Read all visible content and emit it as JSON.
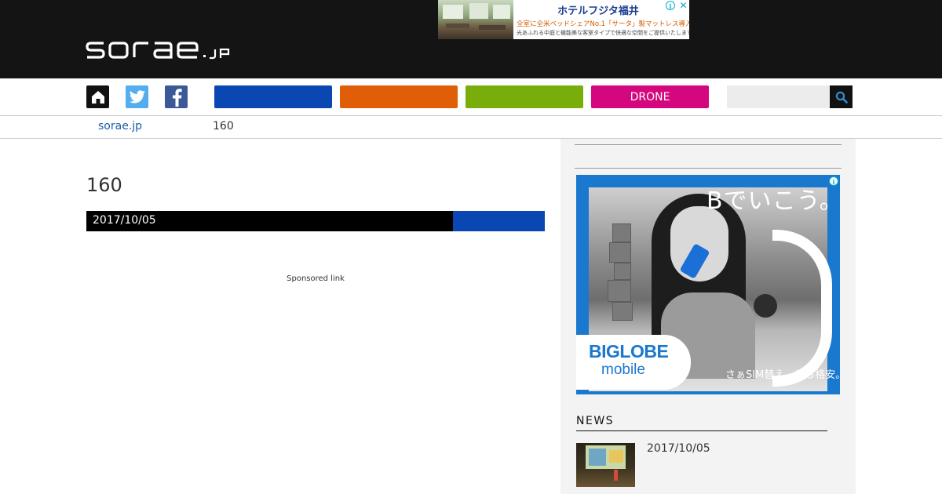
{
  "header": {
    "logo_text": "sorae.jp",
    "top_ad": {
      "title": "ホテルフジタ福井",
      "line1": "全室に全米ベッドシェアNo.1「サータ」製マットレス導入。",
      "line2": "光あふれる中庭と機能美な客室タイプで快適な空間をご提供いたします。",
      "adchoices_icon": "i",
      "close_label": "✕"
    }
  },
  "nav": {
    "home_icon": "home-icon",
    "twitter_icon": "twitter-icon",
    "facebook_icon": "facebook-icon",
    "categories": [
      {
        "label": "",
        "color": "#0b47b3"
      },
      {
        "label": "",
        "color": "#e05e07"
      },
      {
        "label": "",
        "color": "#79ad0c"
      },
      {
        "label": "DRONE",
        "color": "#d4077e"
      }
    ],
    "search": {
      "value": "",
      "placeholder": ""
    },
    "search_icon": "search-icon"
  },
  "breadcrumb": {
    "home": "sorae.jp",
    "current": "160"
  },
  "article": {
    "title": "160",
    "date": "2017/10/05",
    "category_color": "#0b47b3",
    "sponsored_label": "Sponsored link"
  },
  "sidebar": {
    "ad": {
      "headline": "Bでいこう。",
      "brand_top": "BIGLOBE",
      "brand_bottom": "mobile",
      "tagline": "さぁSIM替え、ほら格安。",
      "adchoices_icon": "i"
    },
    "news": {
      "heading": "NEWS",
      "items": [
        {
          "date": "2017/10/05"
        }
      ]
    }
  },
  "colors": {
    "header_bg": "#141414",
    "link": "#1b5ea8",
    "sidebar_bg": "#f2f3f2"
  }
}
